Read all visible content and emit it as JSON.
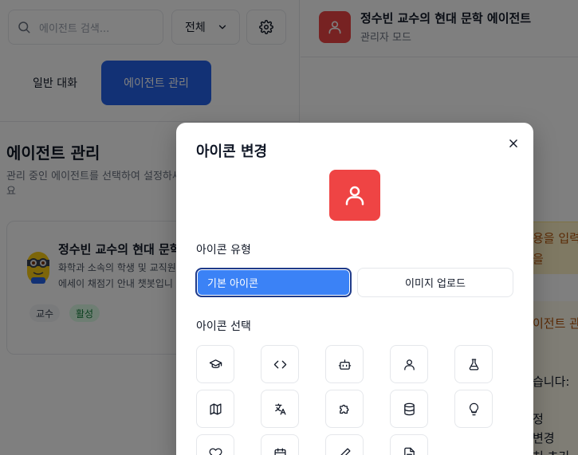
{
  "sidebar": {
    "search_placeholder": "에이전트 검색...",
    "filter_value": "전체",
    "tabs": [
      {
        "label": "일반 대화"
      },
      {
        "label": "에이전트 관리"
      }
    ],
    "management_title": "에이전트 관리",
    "management_desc": "관리 중인 에이전트를 선택하여 설정하세요",
    "agent": {
      "name": "정수빈 교수의 현대 문학",
      "desc_line1": "화학과 소속의 학생 및 교직원",
      "desc_line2": "에세이 채점기 안내 챗봇입니",
      "tags": [
        "교수",
        "활성"
      ]
    }
  },
  "header": {
    "title": "정수빈 교수의 현대 문학 에이전트",
    "subtitle": "관리자 모드"
  },
  "right_fragments": [
    "용을 입력",
    "을",
    "이전트 관",
    "습니다:",
    "정",
    "변경",
    "처 초기"
  ],
  "modal": {
    "title": "아이콘 변경",
    "icon_type_label": "아이콘 유형",
    "type_default": "기본 아이콘",
    "type_upload": "이미지 업로드",
    "icon_select_label": "아이콘 선택",
    "icons": [
      "graduation-cap-icon",
      "code-icon",
      "bot-icon",
      "user-icon",
      "flask-icon",
      "map-icon",
      "translate-icon",
      "puzzle-icon",
      "database-icon",
      "lightbulb-icon",
      "heart-icon",
      "calendar-icon",
      "pencil-icon",
      "document-icon"
    ],
    "selected_icon": "user-icon",
    "accent_color": "#ef4444",
    "selected_type_color": "#3b82f6"
  }
}
